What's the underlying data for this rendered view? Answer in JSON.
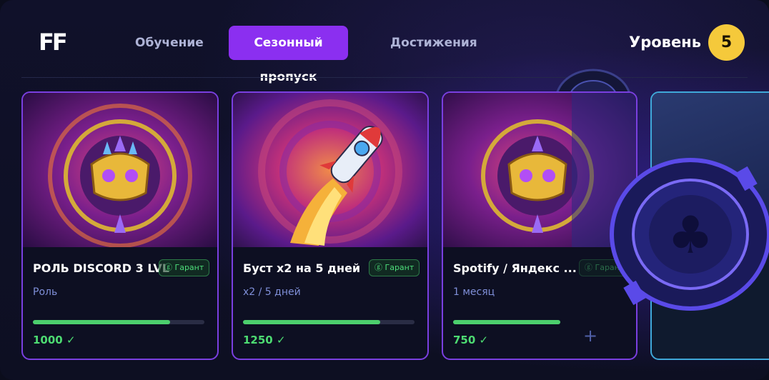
{
  "header": {
    "logo": "FF",
    "tabs": [
      {
        "label": "Обучение",
        "active": false
      },
      {
        "label": "Сезонный пропуск",
        "active": true
      },
      {
        "label": "Достижения",
        "active": false
      }
    ],
    "level_label": "Уровень",
    "level_value": "5"
  },
  "colors": {
    "accent": "#8b2ff0",
    "progress": "#4ccf6d",
    "level_badge": "#f5c93b",
    "guarantee": "#4dde7a"
  },
  "cards": [
    {
      "title": "РОЛЬ DISCORD 3 LVL",
      "badge": "Гарант",
      "subtitle": "Роль",
      "progress": 0.8,
      "points": "1000 ✓",
      "art": "discord-crown-icon"
    },
    {
      "title": "Буст x2 на 5 дней",
      "badge": "Гарант",
      "subtitle": "x2 / 5 дней",
      "progress": 0.8,
      "points": "1250 ✓",
      "art": "rocket-icon"
    },
    {
      "title": "Spotify / Яндекс ...",
      "badge": "Гарант",
      "subtitle": "1 месяц",
      "progress": 0.65,
      "points": "750 ✓",
      "art": "discord-crown-icon"
    }
  ]
}
